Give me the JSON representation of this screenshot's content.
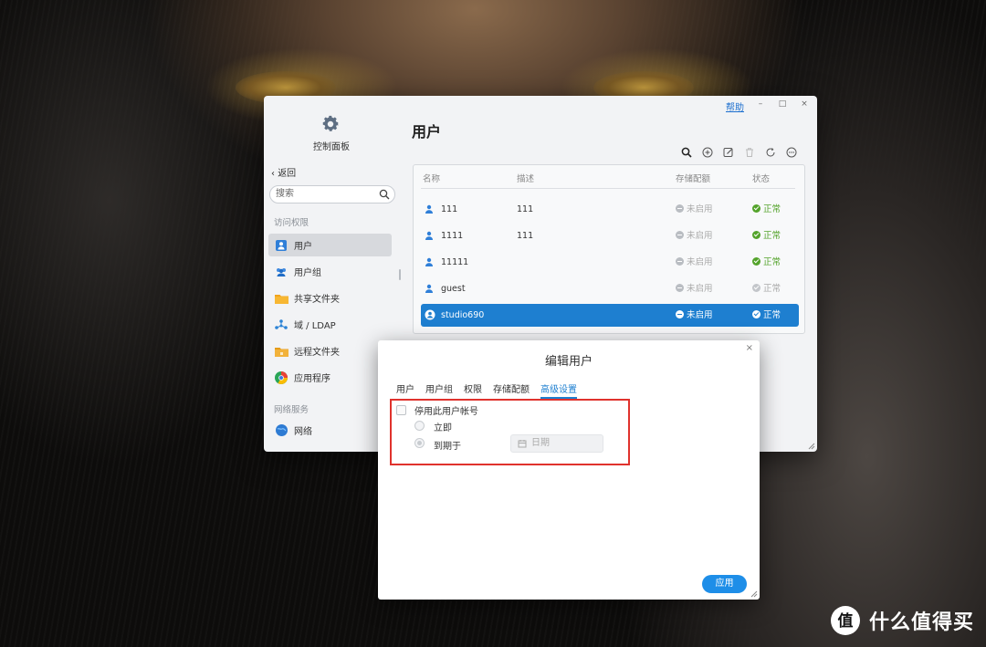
{
  "control_panel": {
    "help": "帮助",
    "window_buttons": {
      "minimize": "–",
      "maximize": "□",
      "close": "×"
    },
    "app_title": "控制面板",
    "back": "返回",
    "search_placeholder": "搜索",
    "section_access": "访问权限",
    "section_network": "网络服务",
    "nav": [
      {
        "label": "用户",
        "icon": "user-icon",
        "active": true
      },
      {
        "label": "用户组",
        "icon": "user-group-icon"
      },
      {
        "label": "共享文件夹",
        "icon": "folder-icon"
      },
      {
        "label": "域 / LDAP",
        "icon": "domain-icon"
      },
      {
        "label": "远程文件夹",
        "icon": "remote-folder-icon"
      },
      {
        "label": "应用程序",
        "icon": "app-icon"
      },
      {
        "label": "网络",
        "icon": "network-icon"
      }
    ],
    "page_title": "用户",
    "toolbar": [
      "search-icon",
      "add-icon",
      "edit-icon",
      "delete-icon",
      "refresh-icon",
      "more-icon"
    ],
    "table": {
      "headers": {
        "name": "名称",
        "desc": "描述",
        "quota": "存储配额",
        "status": "状态"
      },
      "rows": [
        {
          "name": "111",
          "desc": "111",
          "quota": "未启用",
          "status": "正常"
        },
        {
          "name": "1111",
          "desc": "111",
          "quota": "未启用",
          "status": "正常"
        },
        {
          "name": "11111",
          "desc": "",
          "quota": "未启用",
          "status": "正常"
        },
        {
          "name": "guest",
          "desc": "",
          "quota": "未启用",
          "status": "正常"
        },
        {
          "name": "studio690",
          "desc": "",
          "quota": "未启用",
          "status": "正常"
        }
      ]
    }
  },
  "dialog": {
    "title": "编辑用户",
    "close": "×",
    "tabs": [
      "用户",
      "用户组",
      "权限",
      "存储配额",
      "高级设置"
    ],
    "active_tab": "高级设置",
    "disable_account_label": "停用此用户帐号",
    "option_immediately": "立即",
    "option_expire": "到期于",
    "date_placeholder": "日期",
    "apply": "应用"
  },
  "watermark": {
    "text": "什么值得买",
    "logo": "值"
  },
  "colors": {
    "accent": "#1e7fd0",
    "ok": "#53a32a",
    "highlight_box": "#e0322d"
  }
}
